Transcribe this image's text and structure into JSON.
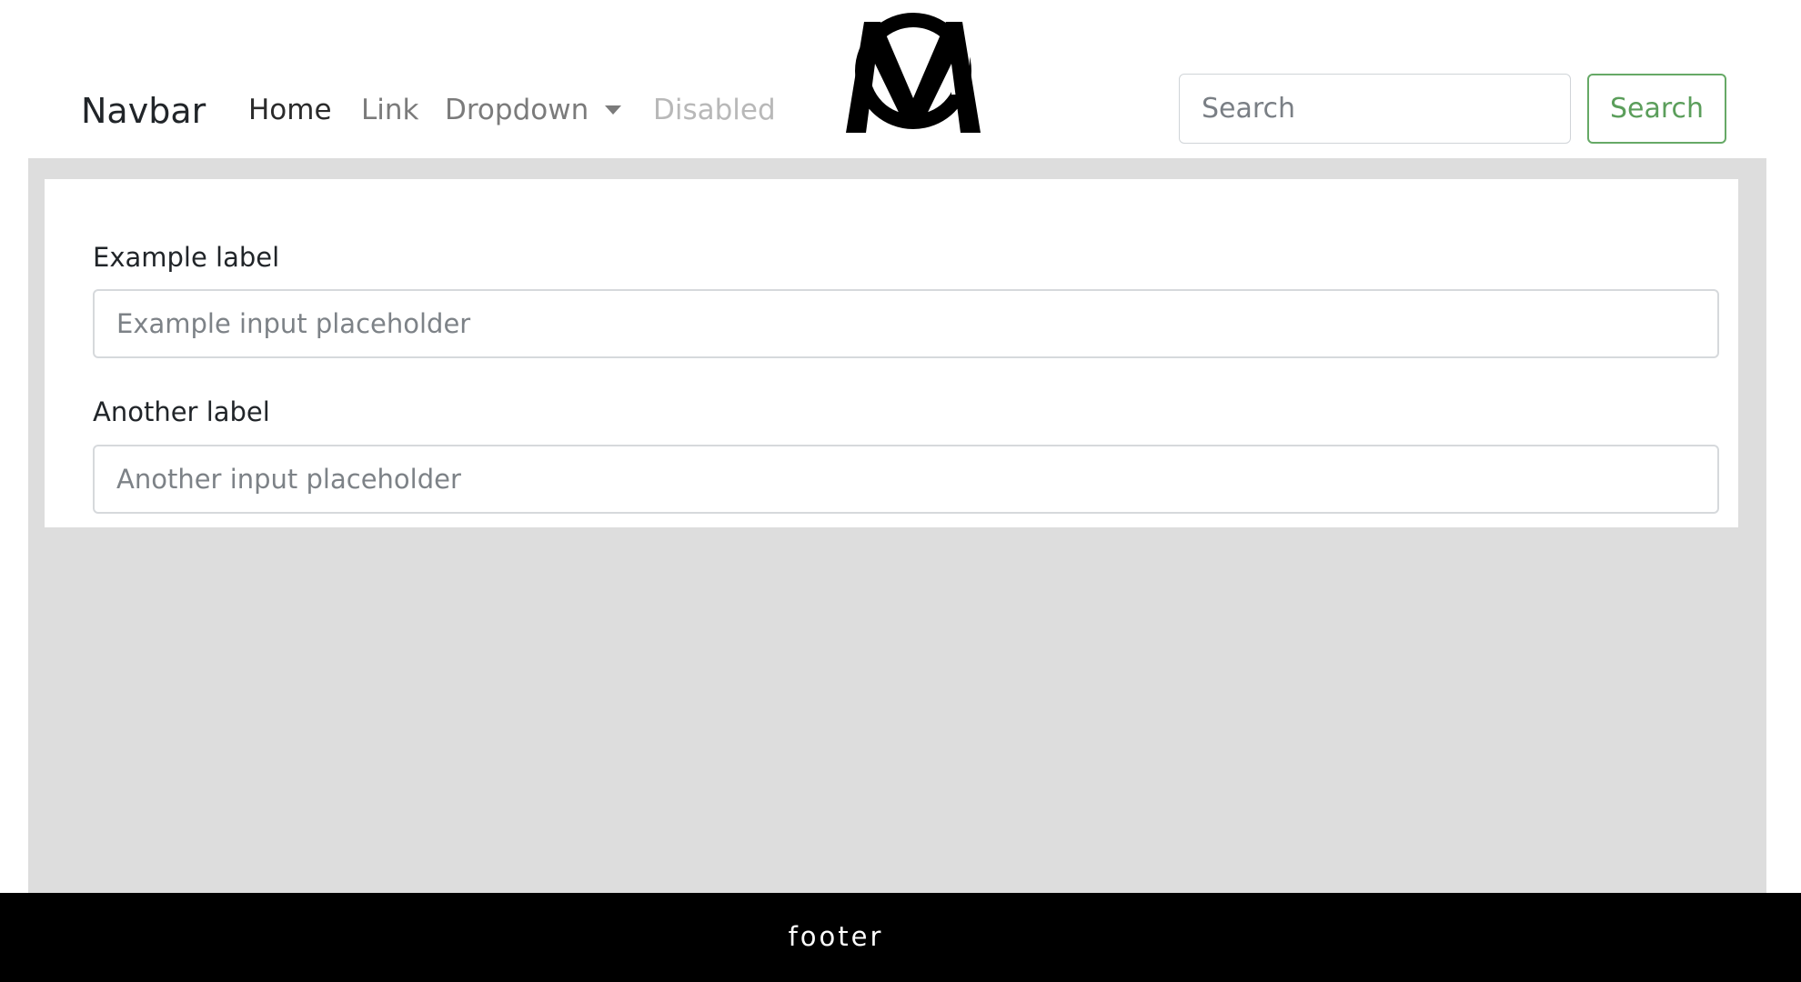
{
  "navbar": {
    "brand": "Navbar",
    "links": {
      "home": "Home",
      "link": "Link",
      "dropdown": "Dropdown",
      "disabled": "Disabled"
    },
    "logo_icon": "cm-monogram-logo",
    "search": {
      "placeholder": "Search",
      "button_label": "Search"
    }
  },
  "form": {
    "field1": {
      "label": "Example label",
      "placeholder": "Example input placeholder",
      "value": ""
    },
    "field2": {
      "label": "Another label",
      "placeholder": "Another input placeholder",
      "value": ""
    }
  },
  "footer": {
    "text": "footer"
  },
  "colors": {
    "main_background": "#dddddd",
    "footer_background": "#000000",
    "search_button_accent": "#5b9e5b",
    "disabled_link": "#b8b8b8"
  }
}
